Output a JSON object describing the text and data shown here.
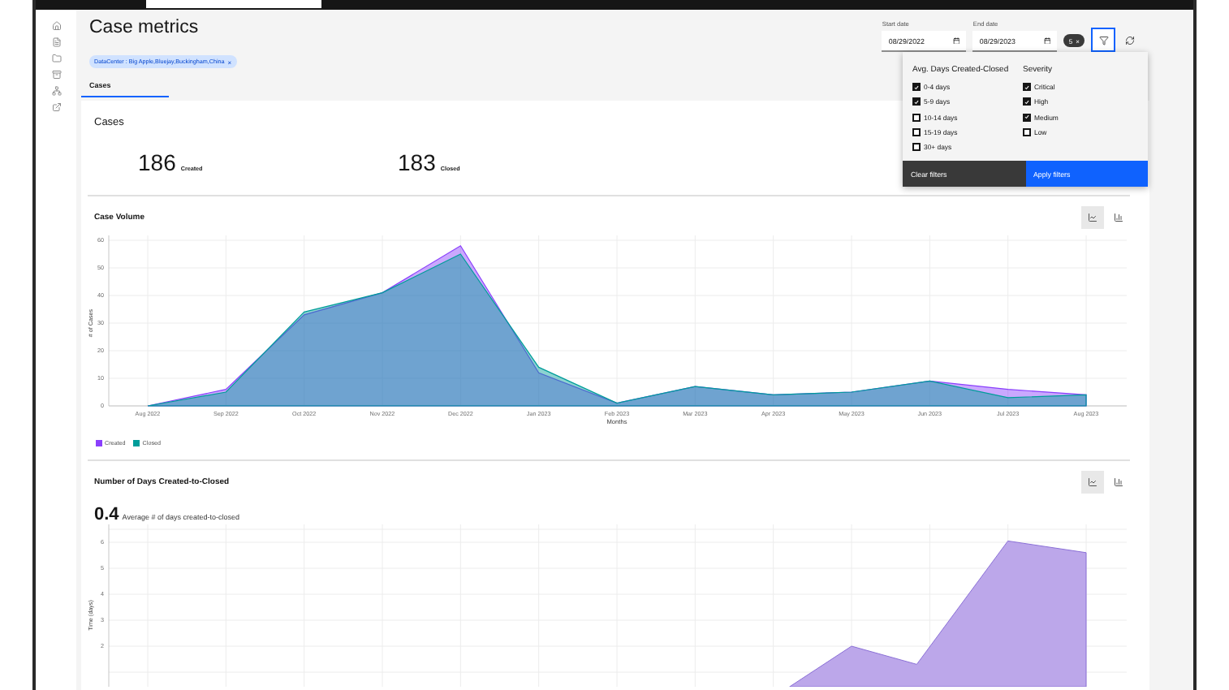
{
  "page": {
    "title": "Case metrics",
    "filter_tags": [
      {
        "label": "DataCenter : Big Apple,Bluejay,Buckingham,China",
        "remove": "×"
      }
    ],
    "tabs": [
      {
        "label": "Cases",
        "selected": true
      }
    ]
  },
  "toolbar": {
    "start_date": {
      "label": "Start date",
      "value": "08/29/2022"
    },
    "end_date": {
      "label": "End date",
      "value": "08/29/2023"
    },
    "filter_count": {
      "label": "5",
      "clear": "×"
    },
    "filter_open": true
  },
  "filter_panel": {
    "groups": [
      {
        "title": "Avg. Days Created-Closed",
        "options": [
          {
            "label": "0-4 days",
            "checked": true
          },
          {
            "label": "5-9 days",
            "checked": true
          },
          {
            "label": "10-14 days",
            "checked": false
          },
          {
            "label": "15-19 days",
            "checked": false
          },
          {
            "label": "30+ days",
            "checked": false
          }
        ]
      },
      {
        "title": "Severity",
        "options": [
          {
            "label": "Critical",
            "checked": true
          },
          {
            "label": "High",
            "checked": true
          },
          {
            "label": "Medium",
            "checked": true
          },
          {
            "label": "Low",
            "checked": false
          }
        ]
      }
    ],
    "buttons": [
      {
        "label": "Clear filters",
        "kind": "secondary"
      },
      {
        "label": "Apply filters",
        "kind": "primary"
      }
    ]
  },
  "summary": {
    "title": "Cases",
    "metrics": [
      {
        "value": "186",
        "label": "Created"
      },
      {
        "value": "183",
        "label": "Closed"
      }
    ]
  },
  "case_volume": {
    "title": "Case Volume",
    "view_modes": [
      {
        "kind": "line",
        "selected": true
      },
      {
        "kind": "bar",
        "selected": false
      }
    ],
    "chart_data": {
      "type": "area",
      "grid": true,
      "xlabel": "Months",
      "ylabel": "# of Cases",
      "categories": [
        "Aug 2022",
        "Sep 2022",
        "Oct 2022",
        "Nov 2022",
        "Dec 2022",
        "Jan 2023",
        "Feb 2023",
        "Mar 2023",
        "Apr 2023",
        "May 2023",
        "Jun 2023",
        "Jul 2023",
        "Aug 2023"
      ],
      "ylim": [
        0,
        60
      ],
      "yticks": [
        0,
        10,
        20,
        30,
        40,
        50,
        60
      ],
      "series": [
        {
          "name": "Created",
          "color": "#8a3ffc",
          "values": [
            0,
            6,
            33,
            41,
            58,
            12,
            1,
            7,
            4,
            5,
            9,
            6,
            4
          ]
        },
        {
          "name": "Closed",
          "color": "#009d9a",
          "values": [
            0,
            5,
            34,
            41,
            55,
            14,
            1,
            7,
            4,
            5,
            9,
            3,
            4
          ]
        }
      ]
    }
  },
  "days_chart": {
    "title": "Number of Days Created-to-Closed",
    "view_modes": [
      {
        "kind": "line",
        "selected": true
      },
      {
        "kind": "bar",
        "selected": false
      }
    ],
    "average": {
      "value": "0.4",
      "label": "Average # of days created-to-closed"
    },
    "ylabel": "Time (days)",
    "yticks": [
      "6",
      "5",
      "4",
      "3",
      "2"
    ]
  }
}
